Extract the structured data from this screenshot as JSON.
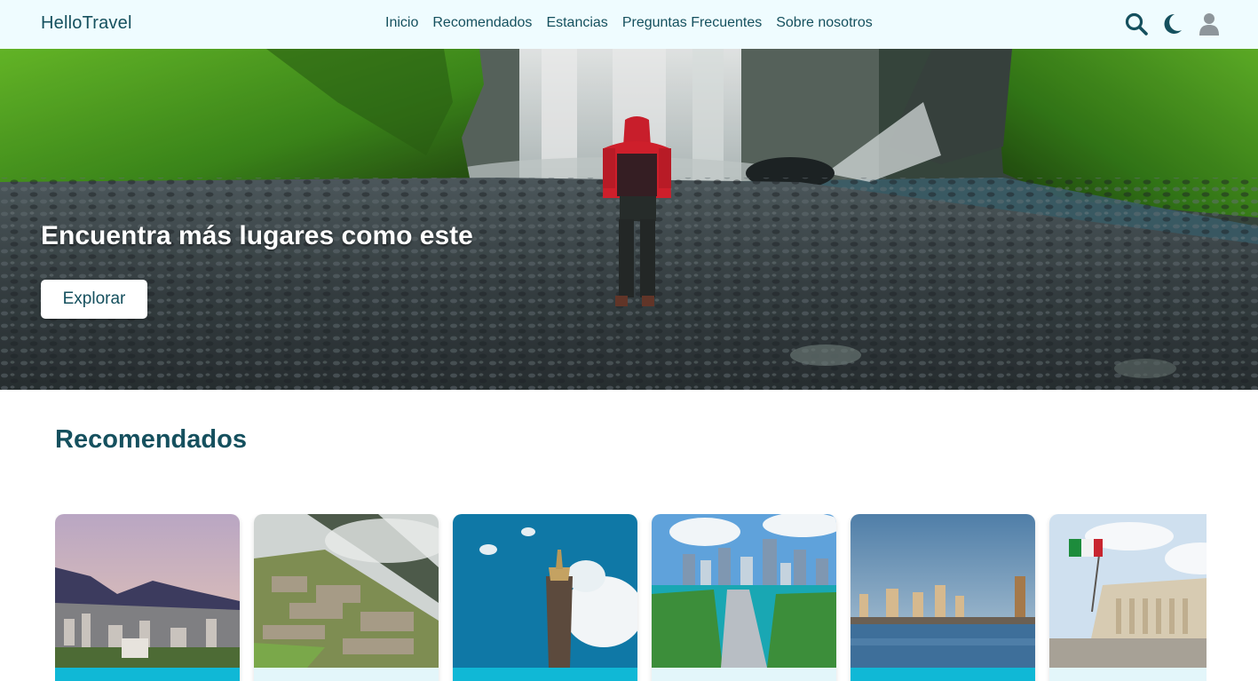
{
  "navbar": {
    "brand": "HelloTravel",
    "links": [
      {
        "label": "Inicio"
      },
      {
        "label": "Recomendados"
      },
      {
        "label": "Estancias"
      },
      {
        "label": "Preguntas Frecuentes"
      },
      {
        "label": "Sobre nosotros"
      }
    ],
    "icons": [
      "search-icon",
      "moon-icon",
      "user-icon"
    ]
  },
  "hero": {
    "title": "Encuentra más lugares como este",
    "button_label": "Explorar"
  },
  "recommended": {
    "title": "Recomendados",
    "cards": [
      {
        "scene": "mountain-city"
      },
      {
        "scene": "ancient-ruins"
      },
      {
        "scene": "monument-column"
      },
      {
        "scene": "coastal-city-bridge"
      },
      {
        "scene": "waterfront-skyline"
      },
      {
        "scene": "classical-monument-flag"
      }
    ]
  },
  "colors": {
    "accent": "#15505e",
    "navbar_bg": "#effcff",
    "card_strip_cyan": "#10b8d6",
    "card_strip_light": "#e3f6fa"
  }
}
